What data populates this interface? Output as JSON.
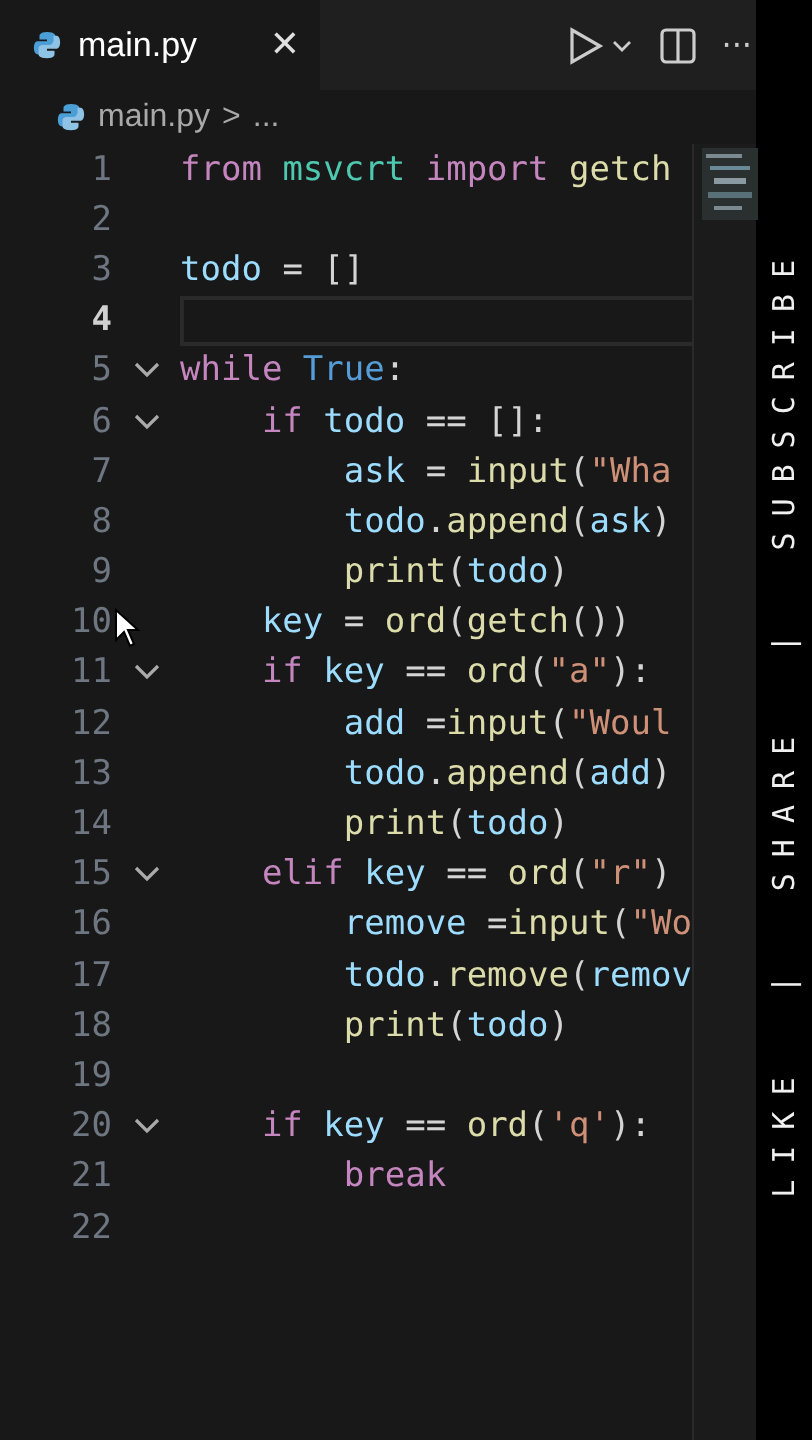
{
  "tab": {
    "title": "main.py",
    "close": "✕",
    "selected": true
  },
  "toolbar": {
    "more": "···"
  },
  "breadcrumb": {
    "file": "main.py",
    "separator": ">",
    "rest": "..."
  },
  "lines": [
    {
      "number": "1",
      "current": false,
      "fold": false,
      "tokens": [
        {
          "kind": "keyword",
          "text": "from"
        },
        {
          "kind": "module",
          "text": " msvcrt"
        },
        {
          "kind": "keyword",
          "text": " import"
        },
        {
          "kind": "function",
          "text": " getch"
        }
      ]
    },
    {
      "number": "2",
      "current": false,
      "fold": false
    },
    {
      "number": "3",
      "current": false,
      "fold": false,
      "tokens": [
        {
          "kind": "variable",
          "text": "todo"
        },
        {
          "kind": "plain",
          "text": " = []"
        }
      ]
    },
    {
      "number": "4",
      "current": true,
      "fold": false
    },
    {
      "number": "5",
      "current": false,
      "fold": true,
      "tokens": [
        {
          "kind": "keyword",
          "text": "while"
        },
        {
          "kind": "constant",
          "text": " True"
        },
        {
          "kind": "plain",
          "text": ":"
        }
      ]
    },
    {
      "number": "6",
      "current": false,
      "fold": true,
      "tokens": [
        {
          "kind": "keyword",
          "text": "    if"
        },
        {
          "kind": "variable",
          "text": " todo"
        },
        {
          "kind": "plain",
          "text": " == []:"
        }
      ]
    },
    {
      "number": "7",
      "current": false,
      "fold": false,
      "tokens": [
        {
          "kind": "variable",
          "text": "        ask"
        },
        {
          "kind": "plain",
          "text": " ="
        },
        {
          "kind": "function",
          "text": " input"
        },
        {
          "kind": "plain",
          "text": "("
        },
        {
          "kind": "string",
          "text": "\"Wha"
        }
      ]
    },
    {
      "number": "8",
      "current": false,
      "fold": false,
      "tokens": [
        {
          "kind": "variable",
          "text": "        todo"
        },
        {
          "kind": "plain",
          "text": "."
        },
        {
          "kind": "function",
          "text": "append"
        },
        {
          "kind": "plain",
          "text": "("
        },
        {
          "kind": "variable",
          "text": "ask"
        },
        {
          "kind": "plain",
          "text": ")"
        }
      ]
    },
    {
      "number": "9",
      "current": false,
      "fold": false,
      "tokens": [
        {
          "kind": "function",
          "text": "        print"
        },
        {
          "kind": "plain",
          "text": "("
        },
        {
          "kind": "variable",
          "text": "todo"
        },
        {
          "kind": "plain",
          "text": ")"
        }
      ]
    },
    {
      "number": "10",
      "current": false,
      "fold": false,
      "tokens": [
        {
          "kind": "variable",
          "text": "    key"
        },
        {
          "kind": "plain",
          "text": " ="
        },
        {
          "kind": "function",
          "text": " ord"
        },
        {
          "kind": "plain",
          "text": "("
        },
        {
          "kind": "function",
          "text": "getch"
        },
        {
          "kind": "plain",
          "text": "())"
        }
      ]
    },
    {
      "number": "11",
      "current": false,
      "fold": true,
      "tokens": [
        {
          "kind": "keyword",
          "text": "    if"
        },
        {
          "kind": "variable",
          "text": " key"
        },
        {
          "kind": "plain",
          "text": " =="
        },
        {
          "kind": "function",
          "text": " ord"
        },
        {
          "kind": "plain",
          "text": "("
        },
        {
          "kind": "string",
          "text": "\"a\""
        },
        {
          "kind": "plain",
          "text": "):"
        }
      ]
    },
    {
      "number": "12",
      "current": false,
      "fold": false,
      "tokens": [
        {
          "kind": "variable",
          "text": "        add"
        },
        {
          "kind": "plain",
          "text": " ="
        },
        {
          "kind": "function",
          "text": "input"
        },
        {
          "kind": "plain",
          "text": "("
        },
        {
          "kind": "string",
          "text": "\"Woul"
        }
      ]
    },
    {
      "number": "13",
      "current": false,
      "fold": false,
      "tokens": [
        {
          "kind": "variable",
          "text": "        todo"
        },
        {
          "kind": "plain",
          "text": "."
        },
        {
          "kind": "function",
          "text": "append"
        },
        {
          "kind": "plain",
          "text": "("
        },
        {
          "kind": "variable",
          "text": "add"
        },
        {
          "kind": "plain",
          "text": ")"
        }
      ]
    },
    {
      "number": "14",
      "current": false,
      "fold": false,
      "tokens": [
        {
          "kind": "function",
          "text": "        print"
        },
        {
          "kind": "plain",
          "text": "("
        },
        {
          "kind": "variable",
          "text": "todo"
        },
        {
          "kind": "plain",
          "text": ")"
        }
      ]
    },
    {
      "number": "15",
      "current": false,
      "fold": true,
      "tokens": [
        {
          "kind": "keyword",
          "text": "    elif"
        },
        {
          "kind": "variable",
          "text": " key"
        },
        {
          "kind": "plain",
          "text": " =="
        },
        {
          "kind": "function",
          "text": " ord"
        },
        {
          "kind": "plain",
          "text": "("
        },
        {
          "kind": "string",
          "text": "\"r\""
        },
        {
          "kind": "plain",
          "text": ")"
        }
      ]
    },
    {
      "number": "16",
      "current": false,
      "fold": false,
      "tokens": [
        {
          "kind": "variable",
          "text": "        remove"
        },
        {
          "kind": "plain",
          "text": " ="
        },
        {
          "kind": "function",
          "text": "input"
        },
        {
          "kind": "plain",
          "text": "("
        },
        {
          "kind": "string",
          "text": "\"Wo"
        }
      ]
    },
    {
      "number": "17",
      "current": false,
      "fold": false,
      "tokens": [
        {
          "kind": "variable",
          "text": "        todo"
        },
        {
          "kind": "plain",
          "text": "."
        },
        {
          "kind": "function",
          "text": "remove"
        },
        {
          "kind": "plain",
          "text": "("
        },
        {
          "kind": "variable",
          "text": "remov"
        }
      ]
    },
    {
      "number": "18",
      "current": false,
      "fold": false,
      "tokens": [
        {
          "kind": "function",
          "text": "        print"
        },
        {
          "kind": "plain",
          "text": "("
        },
        {
          "kind": "variable",
          "text": "todo"
        },
        {
          "kind": "plain",
          "text": ")"
        }
      ]
    },
    {
      "number": "19",
      "current": false,
      "fold": false
    },
    {
      "number": "20",
      "current": false,
      "fold": true,
      "tokens": [
        {
          "kind": "keyword",
          "text": "    if"
        },
        {
          "kind": "variable",
          "text": " key"
        },
        {
          "kind": "plain",
          "text": " =="
        },
        {
          "kind": "function",
          "text": " ord"
        },
        {
          "kind": "plain",
          "text": "("
        },
        {
          "kind": "string",
          "text": "'q'"
        },
        {
          "kind": "plain",
          "text": "):"
        }
      ]
    },
    {
      "number": "21",
      "current": false,
      "fold": false,
      "tokens": [
        {
          "kind": "keyword",
          "text": "        break"
        }
      ]
    },
    {
      "number": "22",
      "current": false,
      "fold": false
    }
  ],
  "side_banner": "LIKE  |  SHARE  |  SUBSCRIBE"
}
